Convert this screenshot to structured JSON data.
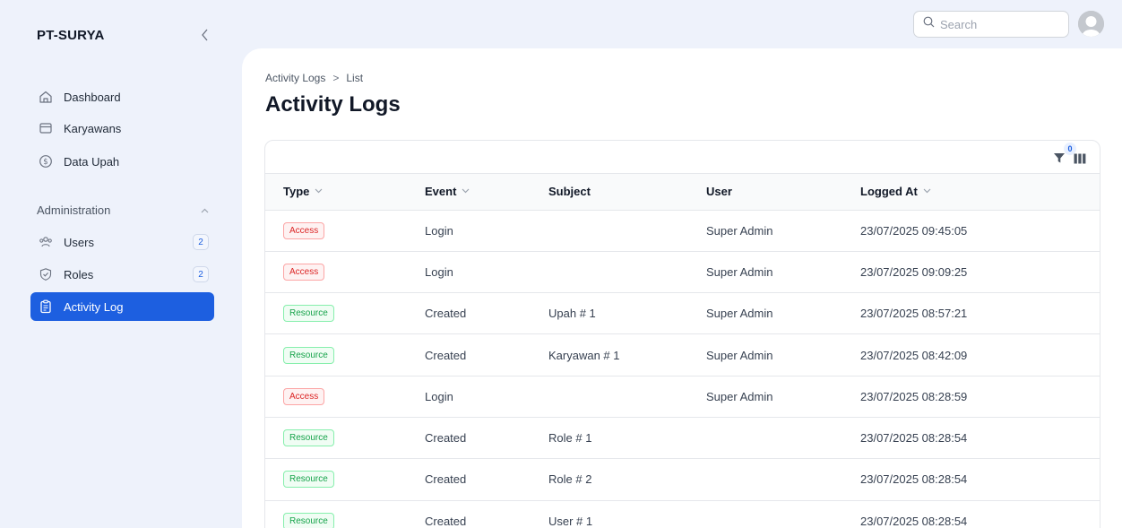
{
  "brand": "PT-SURYA",
  "sidebar": {
    "items": [
      {
        "label": "Dashboard",
        "icon": "home-icon"
      },
      {
        "label": "Karyawans",
        "icon": "archive-icon"
      },
      {
        "label": "Data Upah",
        "icon": "dollar-circle-icon"
      }
    ],
    "group_label": "Administration",
    "admin_items": [
      {
        "label": "Users",
        "icon": "users-icon",
        "badge": "2"
      },
      {
        "label": "Roles",
        "icon": "shield-check-icon",
        "badge": "2"
      },
      {
        "label": "Activity Log",
        "icon": "clipboard-icon",
        "active": true
      }
    ]
  },
  "search": {
    "placeholder": "Search"
  },
  "breadcrumb": {
    "parent": "Activity Logs",
    "separator": ">",
    "current": "List"
  },
  "page_title": "Activity Logs",
  "table": {
    "filter_count": "0",
    "columns": [
      {
        "label": "Type",
        "sortable": true
      },
      {
        "label": "Event",
        "sortable": true
      },
      {
        "label": "Subject",
        "sortable": false
      },
      {
        "label": "User",
        "sortable": false
      },
      {
        "label": "Logged At",
        "sortable": true
      }
    ],
    "rows": [
      {
        "type": "Access",
        "event": "Login",
        "subject": "",
        "user": "Super Admin",
        "logged_at": "23/07/2025 09:45:05"
      },
      {
        "type": "Access",
        "event": "Login",
        "subject": "",
        "user": "Super Admin",
        "logged_at": "23/07/2025 09:09:25"
      },
      {
        "type": "Resource",
        "event": "Created",
        "subject": "Upah # 1",
        "user": "Super Admin",
        "logged_at": "23/07/2025 08:57:21"
      },
      {
        "type": "Resource",
        "event": "Created",
        "subject": "Karyawan # 1",
        "user": "Super Admin",
        "logged_at": "23/07/2025 08:42:09"
      },
      {
        "type": "Access",
        "event": "Login",
        "subject": "",
        "user": "Super Admin",
        "logged_at": "23/07/2025 08:28:59"
      },
      {
        "type": "Resource",
        "event": "Created",
        "subject": "Role # 1",
        "user": "",
        "logged_at": "23/07/2025 08:28:54"
      },
      {
        "type": "Resource",
        "event": "Created",
        "subject": "Role # 2",
        "user": "",
        "logged_at": "23/07/2025 08:28:54"
      },
      {
        "type": "Resource",
        "event": "Created",
        "subject": "User # 1",
        "user": "",
        "logged_at": "23/07/2025 08:28:54"
      }
    ]
  },
  "colors": {
    "accent": "#1d5fe0",
    "access_badge": "#dc2626",
    "resource_badge": "#16a34a",
    "sidebar_bg": "#eef2fb"
  }
}
